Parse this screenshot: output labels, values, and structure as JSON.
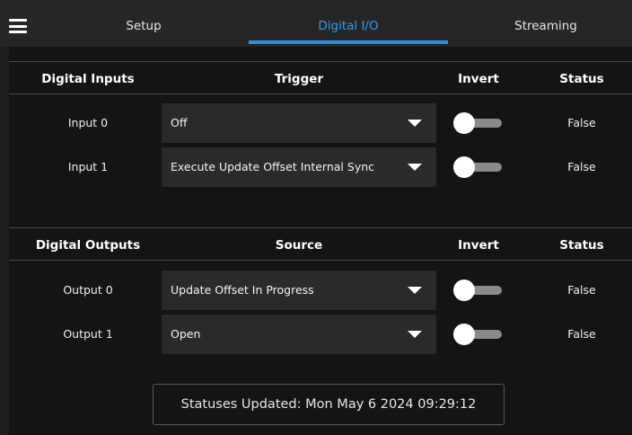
{
  "tabs": [
    {
      "label": "Setup",
      "active": false
    },
    {
      "label": "Digital I/O",
      "active": true
    },
    {
      "label": "Streaming",
      "active": false
    }
  ],
  "colors": {
    "accent": "#2b8fe8",
    "background": "#141414",
    "select_bg": "#2a2a2a"
  },
  "inputs": {
    "header": {
      "name": "Digital Inputs",
      "trigger": "Trigger",
      "invert": "Invert",
      "status": "Status"
    },
    "rows": [
      {
        "label": "Input 0",
        "trigger": "Off",
        "invert": false,
        "status": "False"
      },
      {
        "label": "Input 1",
        "trigger": "Execute Update Offset Internal Sync",
        "invert": false,
        "status": "False"
      }
    ]
  },
  "outputs": {
    "header": {
      "name": "Digital Outputs",
      "source": "Source",
      "invert": "Invert",
      "status": "Status"
    },
    "rows": [
      {
        "label": "Output 0",
        "source": "Update Offset In Progress",
        "invert": false,
        "status": "False"
      },
      {
        "label": "Output 1",
        "source": "Open",
        "invert": false,
        "status": "False"
      }
    ]
  },
  "footer": {
    "statuses_updated": "Statuses Updated:  Mon May 6 2024 09:29:12"
  },
  "icons": {
    "menu": "hamburger-menu-icon",
    "dropdown": "chevron-down-icon"
  }
}
